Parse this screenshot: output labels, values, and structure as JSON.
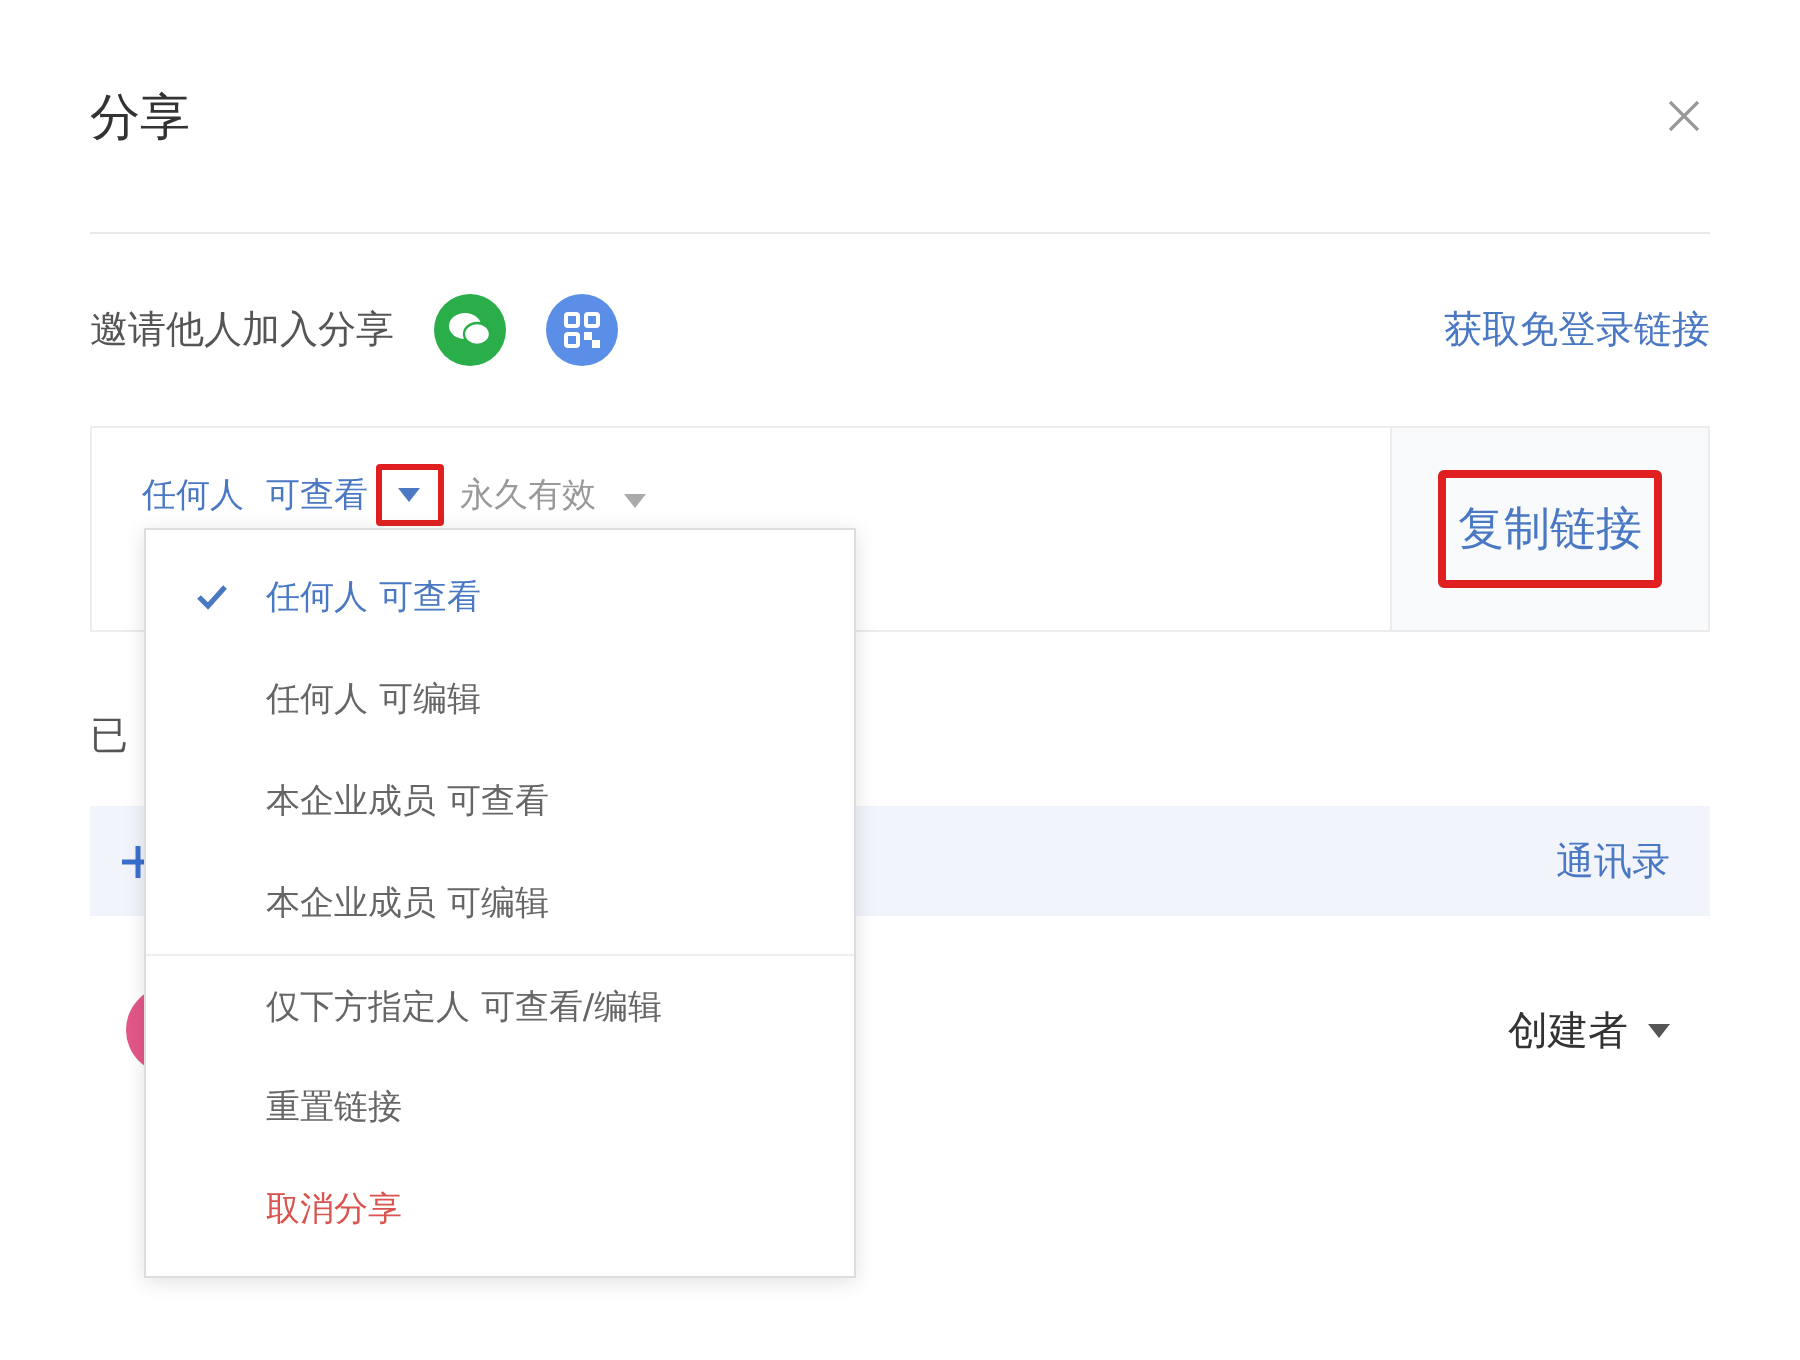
{
  "dialog": {
    "title": "分享"
  },
  "invite": {
    "label": "邀请他人加入分享",
    "link": "获取免登录链接"
  },
  "link_settings": {
    "permission": "任何人  可查看",
    "expiry": "永久有效",
    "copy_button": "复制链接",
    "permission_highlighted": true,
    "copy_highlighted": true
  },
  "members": {
    "label": "已",
    "contacts_link": "通讯录",
    "member_role": "创建者"
  },
  "permission_menu": {
    "items": [
      {
        "label": "任何人 可查看",
        "kind": "option",
        "selected": true
      },
      {
        "label": "任何人 可编辑",
        "kind": "option",
        "selected": false
      },
      {
        "label": "本企业成员 可查看",
        "kind": "option",
        "selected": false
      },
      {
        "label": "本企业成员 可编辑",
        "kind": "option",
        "selected": false
      },
      {
        "label": "仅下方指定人 可查看/编辑",
        "kind": "option",
        "selected": false,
        "divider_before": true
      },
      {
        "label": "重置链接",
        "kind": "action"
      },
      {
        "label": "取消分享",
        "kind": "danger"
      }
    ]
  }
}
